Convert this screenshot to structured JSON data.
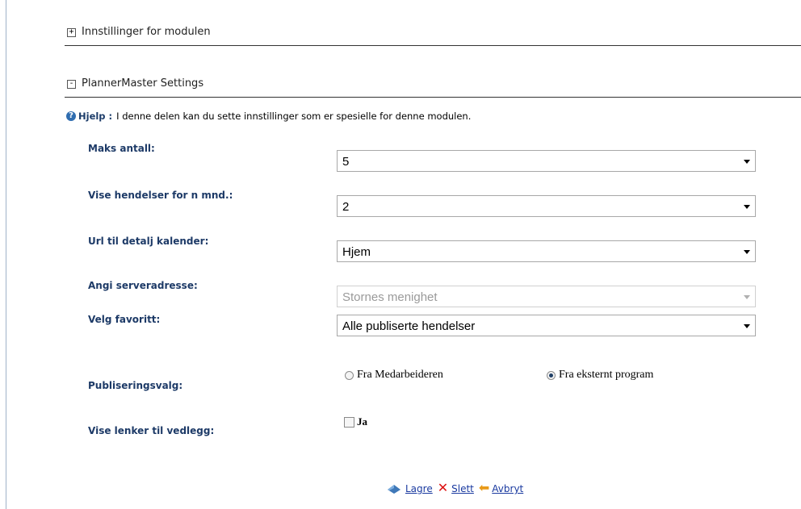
{
  "sections": {
    "module_settings": {
      "toggle": "+",
      "title": "Innstillinger for modulen"
    },
    "plannermaster": {
      "toggle": "-",
      "title": "PlannerMaster Settings"
    }
  },
  "help": {
    "label": "Hjelp :",
    "text": "I denne delen kan du sette innstillinger som er spesielle for denne modulen."
  },
  "form": {
    "max_count": {
      "label": "Maks antall:",
      "value": "5"
    },
    "months": {
      "label": "Vise hendelser for n mnd.:",
      "value": "2"
    },
    "calendar_url": {
      "label": "Url til detalj kalender:",
      "value": "Hjem"
    },
    "server_address": {
      "label": "Angi serveradresse:",
      "value": "Stornes menighet",
      "disabled": true
    },
    "favorite": {
      "label": "Velg favoritt:",
      "value": "Alle publiserte hendelser"
    },
    "publishing": {
      "label": "Publiseringsvalg:",
      "options": [
        {
          "label": "Fra Medarbeideren",
          "checked": false
        },
        {
          "label": "Fra eksternt program",
          "checked": true
        }
      ]
    },
    "attachments": {
      "label": "Vise lenker til vedlegg:",
      "checkbox_label": "Ja",
      "checked": false
    }
  },
  "actions": {
    "save": "Lagre",
    "delete": "Slett",
    "cancel": "Avbryt"
  }
}
